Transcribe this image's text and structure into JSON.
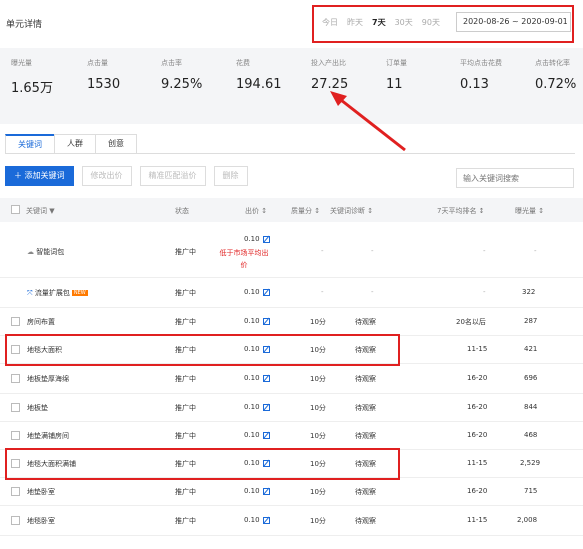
{
  "header": {
    "title": "单元详情",
    "periods": [
      "今日",
      "昨天",
      "7天",
      "30天",
      "90天"
    ],
    "active_period": "7天",
    "date_range": "2020-08-26 ~ 2020-09-01"
  },
  "stats": [
    {
      "label": "曝光量",
      "value": "1.65万"
    },
    {
      "label": "点击量",
      "value": "1530"
    },
    {
      "label": "点击率",
      "value": "9.25%"
    },
    {
      "label": "花费",
      "value": "194.61"
    },
    {
      "label": "投入产出比",
      "value": "27.25"
    },
    {
      "label": "订单量",
      "value": "11"
    },
    {
      "label": "平均点击花费",
      "value": "0.13"
    },
    {
      "label": "点击转化率",
      "value": "0.72%"
    }
  ],
  "tabs": [
    "关键词",
    "人群",
    "创意"
  ],
  "toolbar": {
    "add": "＋ 添加关键词",
    "modify_bid": "修改出价",
    "match_bid": "精准匹配溢价",
    "delete": "删除",
    "search_placeholder": "输入关键词搜索"
  },
  "columns": {
    "keyword": "关键词 ▼",
    "status": "状态",
    "bid": "出价 ↕",
    "quality": "质量分 ↕",
    "diagnosis": "关键词诊断 ↕",
    "rank": "7天平均排名 ↕",
    "impressions": "曝光量 ↕"
  },
  "rows": [
    {
      "keyword": "智能词包",
      "status": "推广中",
      "bid": "0.10",
      "note": "低于市场平均出价",
      "quality": "-",
      "diagnosis": "-",
      "rank": "-",
      "impressions": "-"
    },
    {
      "keyword": "流量扩展包",
      "badge": "NEW",
      "status": "推广中",
      "bid": "0.10",
      "quality": "-",
      "diagnosis": "-",
      "rank": "-",
      "impressions": "322"
    },
    {
      "keyword": "房间布置",
      "status": "推广中",
      "bid": "0.10",
      "quality": "10分",
      "diagnosis": "待观察",
      "rank": "20名以后",
      "impressions": "287"
    },
    {
      "keyword": "地毯大面积",
      "status": "推广中",
      "bid": "0.10",
      "quality": "10分",
      "diagnosis": "待观察",
      "rank": "11-15",
      "impressions": "421"
    },
    {
      "keyword": "地板垫厚海绵",
      "status": "推广中",
      "bid": "0.10",
      "quality": "10分",
      "diagnosis": "待观察",
      "rank": "16-20",
      "impressions": "696"
    },
    {
      "keyword": "地板垫",
      "status": "推广中",
      "bid": "0.10",
      "quality": "10分",
      "diagnosis": "待观察",
      "rank": "16-20",
      "impressions": "844"
    },
    {
      "keyword": "地垫满铺房间",
      "status": "推广中",
      "bid": "0.10",
      "quality": "10分",
      "diagnosis": "待观察",
      "rank": "16-20",
      "impressions": "468"
    },
    {
      "keyword": "地毯大面积满铺",
      "status": "推广中",
      "bid": "0.10",
      "quality": "10分",
      "diagnosis": "待观察",
      "rank": "11-15",
      "impressions": "2,529"
    },
    {
      "keyword": "地垫卧室",
      "status": "推广中",
      "bid": "0.10",
      "quality": "10分",
      "diagnosis": "待观察",
      "rank": "16-20",
      "impressions": "715"
    },
    {
      "keyword": "地毯卧室",
      "status": "推广中",
      "bid": "0.10",
      "quality": "10分",
      "diagnosis": "待观察",
      "rank": "11-15",
      "impressions": "2,008"
    }
  ],
  "colors": {
    "accent": "#1a6ad9",
    "highlight": "#e02020",
    "badge": "#ff7a00"
  }
}
